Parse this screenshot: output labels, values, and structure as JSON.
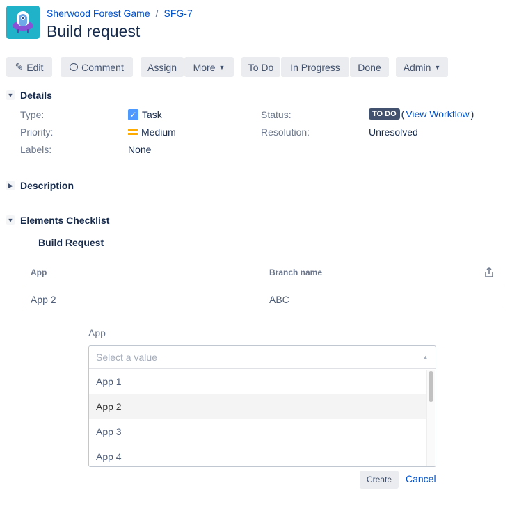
{
  "breadcrumb": {
    "project": "Sherwood Forest Game",
    "separator": "/",
    "issue_key": "SFG-7"
  },
  "title": "Build request",
  "toolbar": {
    "edit": "Edit",
    "comment": "Comment",
    "assign": "Assign",
    "more": "More",
    "todo": "To Do",
    "in_progress": "In Progress",
    "done": "Done",
    "admin": "Admin"
  },
  "details": {
    "heading": "Details",
    "type_label": "Type:",
    "type_value": "Task",
    "priority_label": "Priority:",
    "priority_value": "Medium",
    "labels_label": "Labels:",
    "labels_value": "None",
    "status_label": "Status:",
    "status_badge": "TO DO",
    "view_workflow": "View Workflow",
    "paren_open": "(",
    "paren_close": ")",
    "resolution_label": "Resolution:",
    "resolution_value": "Unresolved"
  },
  "description": {
    "heading": "Description"
  },
  "checklist": {
    "heading": "Elements Checklist",
    "subheading": "Build Request",
    "columns": [
      "App",
      "Branch name"
    ],
    "rows": [
      [
        "App 2",
        "ABC"
      ]
    ]
  },
  "form": {
    "label": "App",
    "placeholder": "Select a value",
    "options": [
      "App 1",
      "App 2",
      "App 3",
      "App 4"
    ],
    "highlighted": "App 2",
    "create": "Create",
    "cancel": "Cancel"
  },
  "colors": {
    "link": "#0052cc",
    "badge": "#42526e",
    "priority": "#ffab00",
    "checkbox": "#4c9aff"
  }
}
